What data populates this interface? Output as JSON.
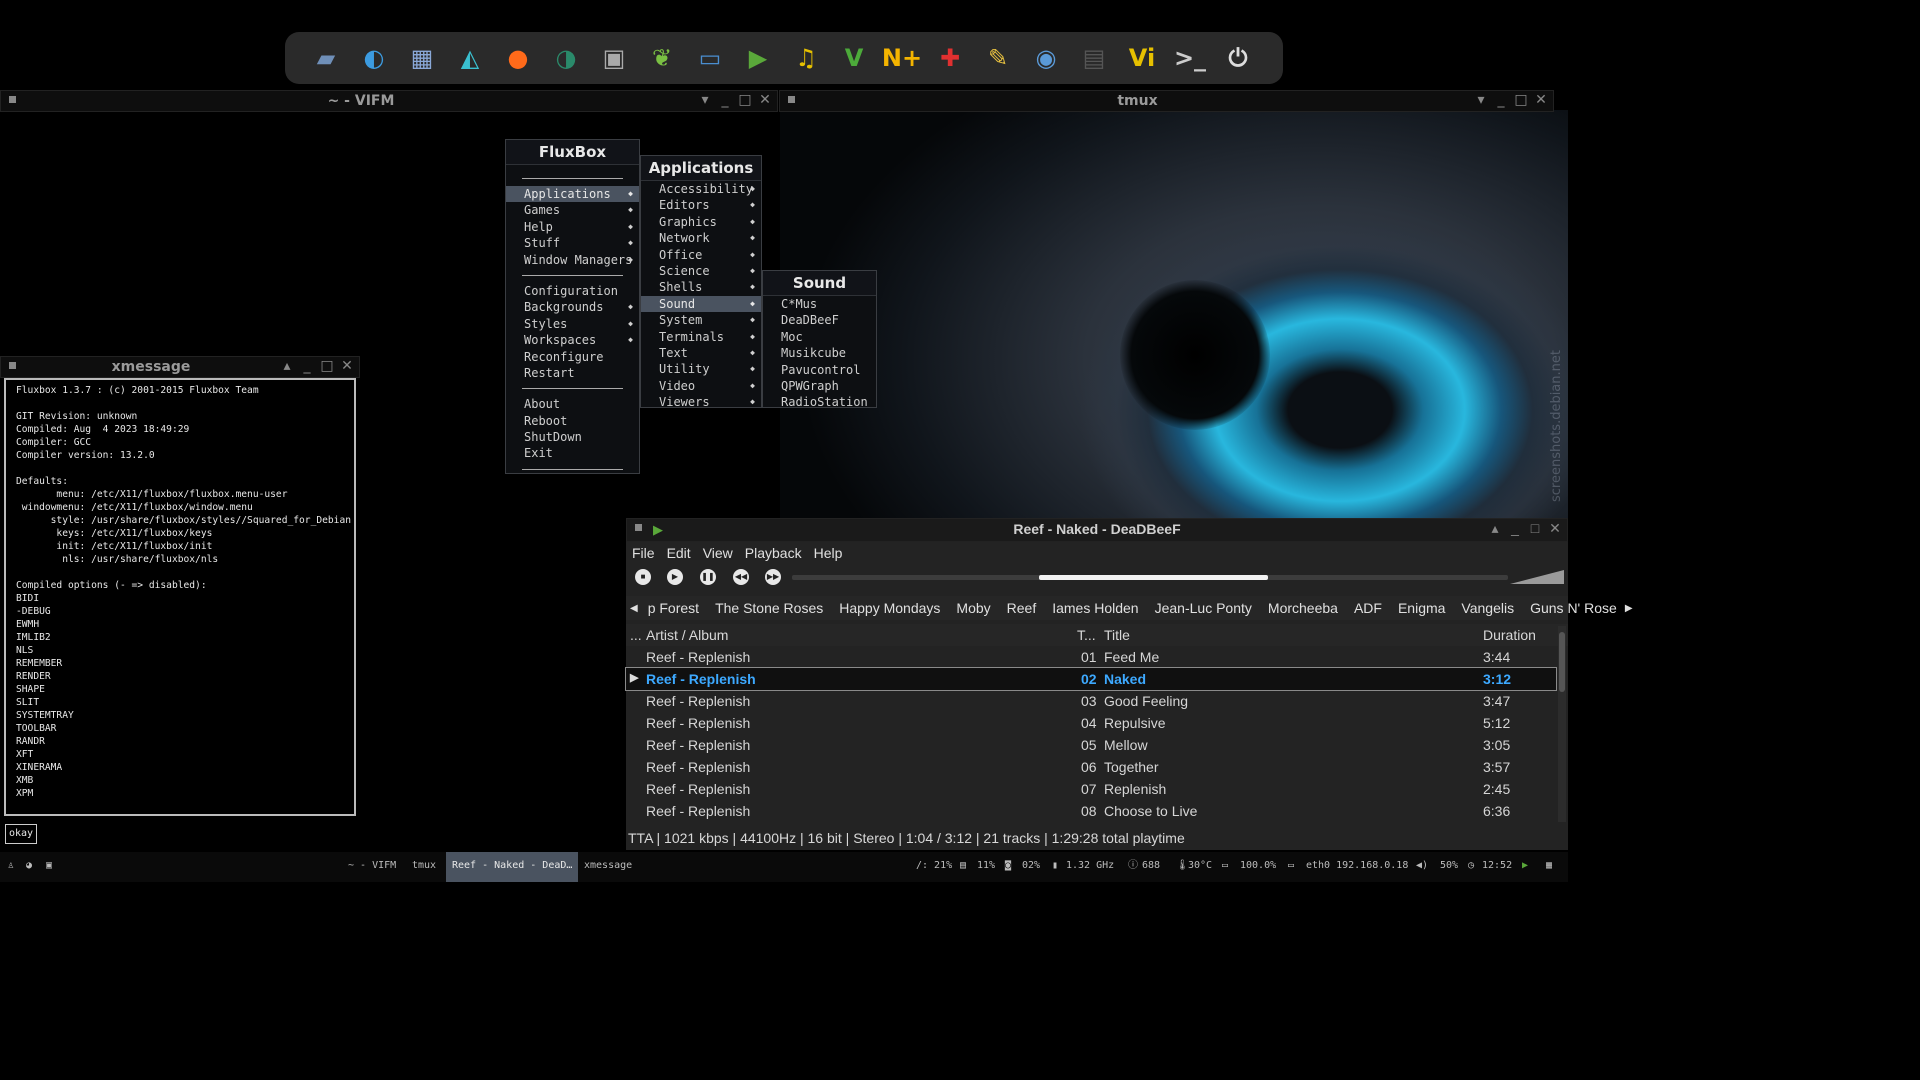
{
  "dock": {
    "icons": [
      {
        "name": "file-manager-icon",
        "glyph": "▰",
        "color": "#6f8fb8"
      },
      {
        "name": "browser-swift-icon",
        "glyph": "◐",
        "color": "#3c9be0"
      },
      {
        "name": "image-viewer-icon",
        "glyph": "▦",
        "color": "#8aa8d8"
      },
      {
        "name": "wolf-icon",
        "glyph": "◭",
        "color": "#3ac0d0"
      },
      {
        "name": "firefox-icon",
        "glyph": "●",
        "color": "#ff6a1a"
      },
      {
        "name": "thunderbird-icon",
        "glyph": "◑",
        "color": "#2a8a6a"
      },
      {
        "name": "camera-icon",
        "glyph": "▣",
        "color": "#aaaaaa"
      },
      {
        "name": "leaf-editor-icon",
        "glyph": "❦",
        "color": "#7ac043"
      },
      {
        "name": "display-icon",
        "glyph": "▭",
        "color": "#4a8ed0"
      },
      {
        "name": "player-play-icon",
        "glyph": "▶",
        "color": "#5aa83a"
      },
      {
        "name": "music-icon",
        "glyph": "♫",
        "color": "#e6c000"
      },
      {
        "name": "vim-green-icon",
        "glyph": "V",
        "color": "#4caa3a"
      },
      {
        "name": "notepad-plus-icon",
        "glyph": "N+",
        "color": "#f4b400"
      },
      {
        "name": "joystick-icon",
        "glyph": "✚",
        "color": "#e03030"
      },
      {
        "name": "broom-cleaner-icon",
        "glyph": "✎",
        "color": "#e6c040"
      },
      {
        "name": "disc-burner-icon",
        "glyph": "◉",
        "color": "#5a9ad8"
      },
      {
        "name": "printer-icon",
        "glyph": "▤",
        "color": "#555555"
      },
      {
        "name": "vi-editor-icon",
        "glyph": "Vi",
        "color": "#e6c000"
      },
      {
        "name": "terminal-icon",
        "glyph": ">_",
        "color": "#cccccc"
      },
      {
        "name": "power-icon",
        "glyph": "⏻",
        "color": "#dddddd"
      }
    ]
  },
  "windows": {
    "vifm_title": "~ - VIFM",
    "tmux_title": "tmux",
    "xmessage_title": "xmessage"
  },
  "watermark": "screenshots.debian.net",
  "fluxbox_menu": {
    "title": "FluxBox",
    "groups": [
      [
        "Applications",
        "Games",
        "Help",
        "Stuff",
        "Window Managers"
      ],
      [
        "Configuration",
        "Backgrounds",
        "Styles",
        "Workspaces",
        "Reconfigure",
        "Restart"
      ],
      [
        "About",
        "Reboot",
        "ShutDown",
        "Exit"
      ]
    ]
  },
  "applications_menu": {
    "title": "Applications",
    "items": [
      "Accessibility",
      "Editors",
      "Graphics",
      "Network",
      "Office",
      "Science",
      "Shells",
      "Sound",
      "System",
      "Terminals",
      "Text",
      "Utility",
      "Video",
      "Viewers"
    ]
  },
  "sound_menu": {
    "title": "Sound",
    "items": [
      "C*Mus",
      "DeaDBeeF",
      "Moc",
      "Musikcube",
      "Pavucontrol",
      "QPWGraph",
      "RadioStation"
    ]
  },
  "xmessage": {
    "text": "Fluxbox 1.3.7 : (c) 2001-2015 Fluxbox Team\n\nGIT Revision: unknown\nCompiled: Aug  4 2023 18:49:29\nCompiler: GCC\nCompiler version: 13.2.0\n\nDefaults:\n       menu: /etc/X11/fluxbox/fluxbox.menu-user\n windowmenu: /etc/X11/fluxbox/window.menu\n      style: /usr/share/fluxbox/styles//Squared_for_Debian\n       keys: /etc/X11/fluxbox/keys\n       init: /etc/X11/fluxbox/init\n        nls: /usr/share/fluxbox/nls\n\nCompiled options (- => disabled):\nBIDI\n-DEBUG\nEWMH\nIMLIB2\nNLS\nREMEMBER\nRENDER\nSHAPE\nSLIT\nSYSTEMTRAY\nTOOLBAR\nRANDR\nXFT\nXINERAMA\nXMB\nXPM",
    "button": "okay"
  },
  "deadbeef": {
    "title": "Reef - Naked - DeaDBeeF",
    "menubar": [
      "File",
      "Edit",
      "View",
      "Playback",
      "Help"
    ],
    "seek_progress": 0.32,
    "tabs": [
      "p Forest",
      "The Stone Roses",
      "Happy Mondays",
      "Moby",
      "Reef",
      "Iames Holden",
      "Jean-Luc Ponty",
      "Morcheeba",
      "ADF",
      "Enigma",
      "Vangelis",
      "Guns N' Rose"
    ],
    "columns": {
      "playing": "...",
      "artist": "Artist / Album",
      "track": "T...",
      "title": "Title",
      "duration": "Duration"
    },
    "rows": [
      {
        "artist": "Reef - Replenish",
        "track": "01",
        "title": "Feed Me",
        "duration": "3:44",
        "playing": false
      },
      {
        "artist": "Reef - Replenish",
        "track": "02",
        "title": "Naked",
        "duration": "3:12",
        "playing": true
      },
      {
        "artist": "Reef - Replenish",
        "track": "03",
        "title": "Good Feeling",
        "duration": "3:47",
        "playing": false
      },
      {
        "artist": "Reef - Replenish",
        "track": "04",
        "title": "Repulsive",
        "duration": "5:12",
        "playing": false
      },
      {
        "artist": "Reef - Replenish",
        "track": "05",
        "title": "Mellow",
        "duration": "3:05",
        "playing": false
      },
      {
        "artist": "Reef - Replenish",
        "track": "06",
        "title": "Together",
        "duration": "3:57",
        "playing": false
      },
      {
        "artist": "Reef - Replenish",
        "track": "07",
        "title": "Replenish",
        "duration": "2:45",
        "playing": false
      },
      {
        "artist": "Reef - Replenish",
        "track": "08",
        "title": "Choose to Live",
        "duration": "6:36",
        "playing": false
      }
    ],
    "status": "TTA | 1021 kbps | 44100Hz | 16 bit | Stereo | 1:04 / 3:12 | 21 tracks | 1:29:28 total playtime"
  },
  "taskbar": {
    "tasks": [
      "~ - VIFM",
      "tmux",
      "Reef - Naked - DeaD…",
      "xmessage"
    ],
    "stats": {
      "disk": "/: 21%",
      "mem": "11%",
      "cpu": "02%",
      "freq": "1.32 GHz",
      "procs": "688",
      "temp": "30°C",
      "battery": "100.0%",
      "net": "eth0 192.168.0.18",
      "volume": "50%",
      "clock": "12:52"
    }
  }
}
